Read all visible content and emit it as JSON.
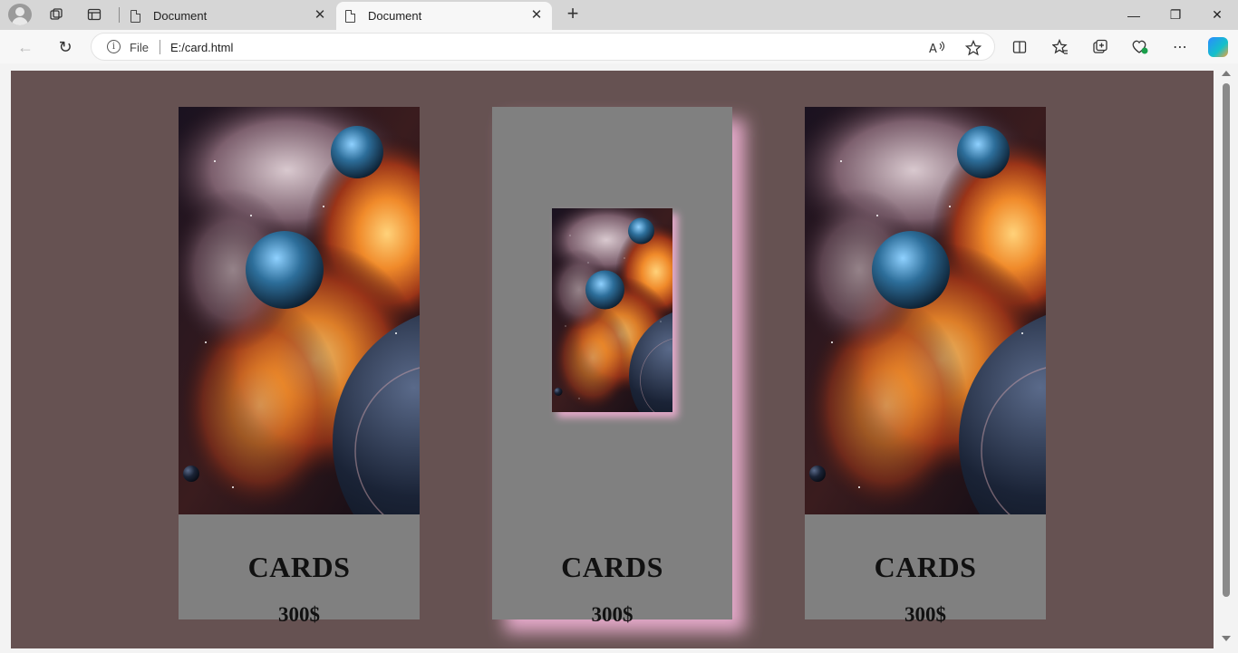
{
  "browser": {
    "tabs": [
      {
        "title": "Document",
        "active": false
      },
      {
        "title": "Document",
        "active": true
      }
    ],
    "address": {
      "scheme_label": "File",
      "url": "E:/card.html"
    }
  },
  "icons": {
    "tab_close": "✕",
    "new_tab": "+",
    "back": "←",
    "reload": "↻",
    "minimize": "—",
    "restore": "❐",
    "close": "✕",
    "info": "i",
    "more": "⋯"
  },
  "colors": {
    "page_background": "#665252",
    "card_background": "#808080",
    "hover_shadow": "#e4a9c9"
  },
  "cards": [
    {
      "title": "CARDS",
      "price": "300$",
      "state": "normal"
    },
    {
      "title": "CARDS",
      "price": "300$",
      "state": "hover"
    },
    {
      "title": "CARDS",
      "price": "300$",
      "state": "normal"
    }
  ]
}
